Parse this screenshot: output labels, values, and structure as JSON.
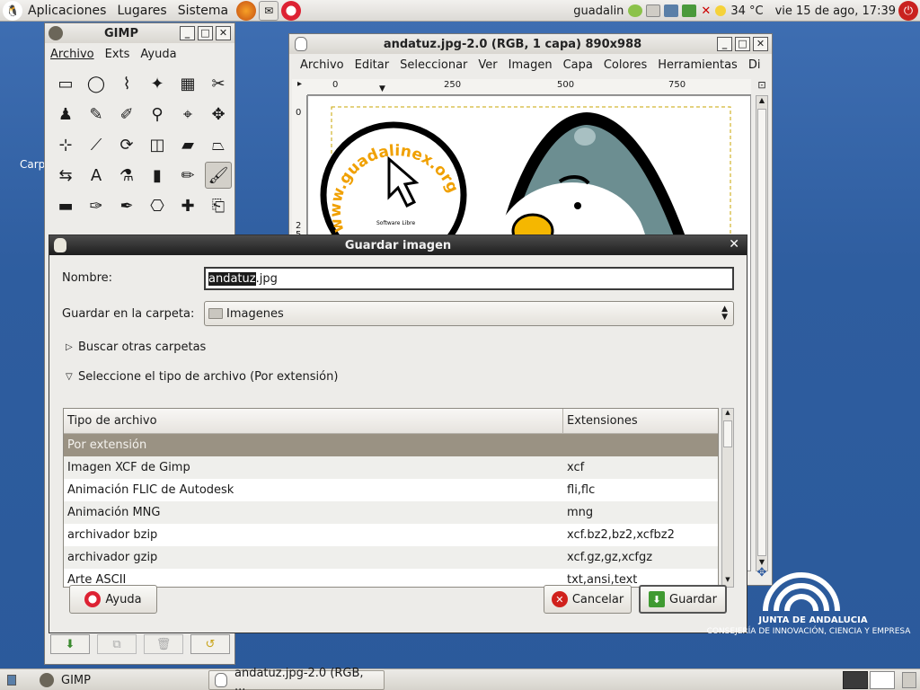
{
  "top_panel": {
    "menus": [
      "Aplicaciones",
      "Lugares",
      "Sistema"
    ],
    "user": "guadalin",
    "temperature": "34 °C",
    "datetime": "vie 15 de ago, 17:39"
  },
  "toolbox": {
    "title": "GIMP",
    "menus": [
      "Archivo",
      "Exts",
      "Ayuda"
    ],
    "tools": [
      "rect-select-icon",
      "ellipse-select-icon",
      "lasso-icon",
      "fuzzy-select-icon",
      "color-select-icon",
      "scissors-icon",
      "foreground-select-icon",
      "paths-icon",
      "color-picker-icon",
      "zoom-icon",
      "measure-icon",
      "move-icon",
      "align-icon",
      "crop-icon",
      "rotate-icon",
      "scale-icon",
      "shear-icon",
      "perspective-icon",
      "flip-icon",
      "text-icon",
      "bucket-fill-icon",
      "blend-icon",
      "pencil-icon",
      "paintbrush-icon",
      "eraser-icon",
      "airbrush-icon",
      "ink-icon",
      "clone-icon",
      "heal-icon",
      "perspective-clone-icon"
    ],
    "tool_glyphs": [
      "▭",
      "◯",
      "⌇",
      "✦",
      "▦",
      "✂",
      "♟",
      "✎",
      "✐",
      "⚲",
      "⌖",
      "✥",
      "⊹",
      "⟋",
      "⟳",
      "◫",
      "▰",
      "⏢",
      "⇆",
      "A",
      "⚗",
      "▮",
      "✏",
      "🖌",
      "▬",
      "✑",
      "✒",
      "⎔",
      "✚",
      "⎗"
    ],
    "selected_tool": 23
  },
  "image_window": {
    "title": "andatuz.jpg-2.0 (RGB, 1 capa) 890x988",
    "menus": [
      "Archivo",
      "Editar",
      "Seleccionar",
      "Ver",
      "Imagen",
      "Capa",
      "Colores",
      "Herramientas",
      "Di"
    ],
    "ruler_h": [
      "0",
      "250",
      "500",
      "750"
    ],
    "ruler_v": [
      "0",
      "2",
      "5"
    ],
    "canvas_text": "www.guadalinex.org",
    "canvas_small": "Software Libre"
  },
  "dialog": {
    "title": "Guardar imagen",
    "name_label": "Nombre:",
    "name_selected": "andatuz",
    "name_rest": ".jpg",
    "folder_label": "Guardar en la carpeta:",
    "folder_value": "Imagenes",
    "browse_label": "Buscar otras carpetas",
    "type_label": "Seleccione el tipo de archivo (Por extensión)",
    "columns": [
      "Tipo de archivo",
      "Extensiones"
    ],
    "rows": [
      {
        "type": "Por extensión",
        "ext": ""
      },
      {
        "type": "Imagen XCF de Gimp",
        "ext": "xcf"
      },
      {
        "type": "Animación FLIC de Autodesk",
        "ext": "fli,flc"
      },
      {
        "type": "Animación MNG",
        "ext": "mng"
      },
      {
        "type": "archivador bzip",
        "ext": "xcf.bz2,bz2,xcfbz2"
      },
      {
        "type": "archivador gzip",
        "ext": "xcf.gz,gz,xcfgz"
      },
      {
        "type": "Arte ASCII",
        "ext": "txt,ansi,text"
      }
    ],
    "help_button": "Ayuda",
    "cancel_button": "Cancelar",
    "save_button": "Guardar"
  },
  "bottom_panel": {
    "task_gimp": "GIMP",
    "task_image": "andatuz.jpg-2.0 (RGB, ..."
  },
  "desktop": {
    "logo_line1": "JUNTA DE ANDALUCIA",
    "logo_line2": "CONSEJERÍA DE INNOVACIÓN, CIENCIA Y EMPRESA"
  },
  "colors": {
    "desktop_bg": "#2e5d9f",
    "dialog_title_bg": "#1d1d1d",
    "selected_row": "#9a9283"
  }
}
